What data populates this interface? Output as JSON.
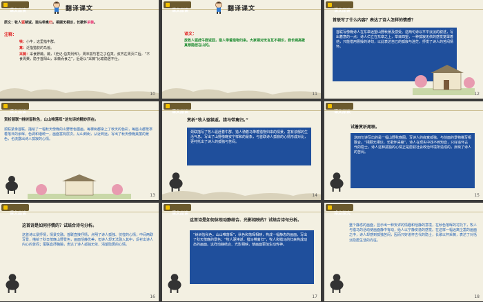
{
  "slides": [
    {
      "page": "10",
      "header": "课文品读",
      "title": "翻译课文",
      "line1_a": "原文：牧人",
      "line1_b": "驱",
      "line1_c": "犊返，猎马带禽",
      "line1_d": "归",
      "line1_e": "。相顾无相识，长歌怀",
      "line1_f": "采薇",
      "line1_g": "。",
      "notes_label": "注释：",
      "n1_k": "犊：",
      "n1_v": "小牛，这里指牛群。",
      "n2_k": "禽：",
      "n2_v": "泛指猎获的鸟兽。",
      "n3_k": "采薇：",
      "n3_v": "采食野薇。薇，《史记·伯夷列传》，周末孤竹君之子伯夷，叔齐在周灭亡后，“不食周粟，隐于首阳山，采薇而食之”，后逐以“采薇”比喻隐居不仕。"
    },
    {
      "page": "11",
      "header": "课文品读",
      "title": "翻译课文",
      "label": "译文：",
      "text": "放牧人驱赶牛群返回，猎人带着猎物归来。大家相对无言互不相识，我长啸高歌真想隐居在山冈。"
    },
    {
      "page": "12",
      "header": "课文品读",
      "question": "首联写了什么内容？表达了诗人怎样的情感？",
      "answer": "首联写傍晚诗人在东皋远望山野秋景及感受。这两句诗以平平淡淡的叙述，写出着意的一点：诗人伫立在东皋之上，举目四望，一种孤寂无依的感觉笼罩着他，只能借用曹操的诗句，以此表达自己的孤寂与迷茫，抒发了诗人的苦闷情怀。"
    },
    {
      "page": "13",
      "header": "课文品读",
      "question": "赏析颔联“树树皆秋色，山山唯落晖”这句诗的精妙所在。",
      "answer": "颔联紧承首联，描绘了一幅秋天傍晚的山野景色图画。每棵树都染上了秋天的色彩，每座山都笼罩着落日的余晖，色调和谐统一，画面富有层次。从山到树，从近到远，写出了秋天傍晚美丽的景色，也流露出诗人孤寂的心情。"
    },
    {
      "page": "14",
      "header": "课文品读",
      "question": "赏析“牧人驱犊返，猎马带禽归。”",
      "answer": "颈联描写了牧人驱赶着牛群，猎人骑着马带着猎物归来的情景，富有浓郁的生活气息，写出了山野傍晚安宁祥和的景象，与首联诗人孤寂的心情形成对比，更衬托出了诗人的孤独与苦闷。"
    },
    {
      "page": "15",
      "header": "课文品读",
      "question": "试着赏析尾联。",
      "answer": "这四句诗写出的是一幅山野秋晚图，写诗人的寂寞孤独，与前面的景物描写相融合。“相顾无相识，长歌怀采薇”，诗人在现实中找不到知音，只好追怀古代的隐士。诗人这种孤独的心情正是唐初社会政治环境所造成的，反映了诗人的苦闷。"
    },
    {
      "page": "16",
      "header": "课文品读",
      "question": "这首诗是如何抒情的？试结合诗句分析。",
      "answer": "这首诗以景抒情，情景交融。首联直接抒情，点明了诗人孤独、彷徨的心情；中间两联写景，描绘了秋日傍晚山野景色，画面恬静优美，但诗人却无法融入其中，反衬出诗人内心的苦闷；尾联直抒胸臆，表达了诗人孤独无依、渴望隐居的心情。"
    },
    {
      "page": "17",
      "header": "课文品读",
      "question": "这首诗是如何体现动静结合、光影相映的？试结合诗句分析。",
      "answer": "“树树皆秋色，山山唯落晖”，秋色和落晖相映，构成一幅静态的画面，写出了秋天傍晚的景色；“牧人驱犊返，猎马带禽归”，牧人和猎马的归来构成动态的画面。这样动静结合、光影相映，使画面更加生动传神。"
    },
    {
      "page": "18",
      "header": "难点探究",
      "answer": "整个静态的画面，显示出一种安详的情趣和恬静的意境，在秋色落晖的衬托下，牧人与猎马的活动使画面静中有动，给人以宁静安逸的感觉。在这样一幅远离尘嚣的画面之中，诗人却感到孤独苦闷，因而只好追怀古代的隐士，长歌以怀采薇，表达了对恬淡隐居生活的向往。"
    }
  ],
  "colors": {
    "header_chip": "#6b5a2e",
    "header_square": "#f2c000",
    "answer_box": "#1f4f9c",
    "slide_bg": "#f3f0e2",
    "highlight_red": "#e02020",
    "highlight_pink": "#e8407a"
  }
}
